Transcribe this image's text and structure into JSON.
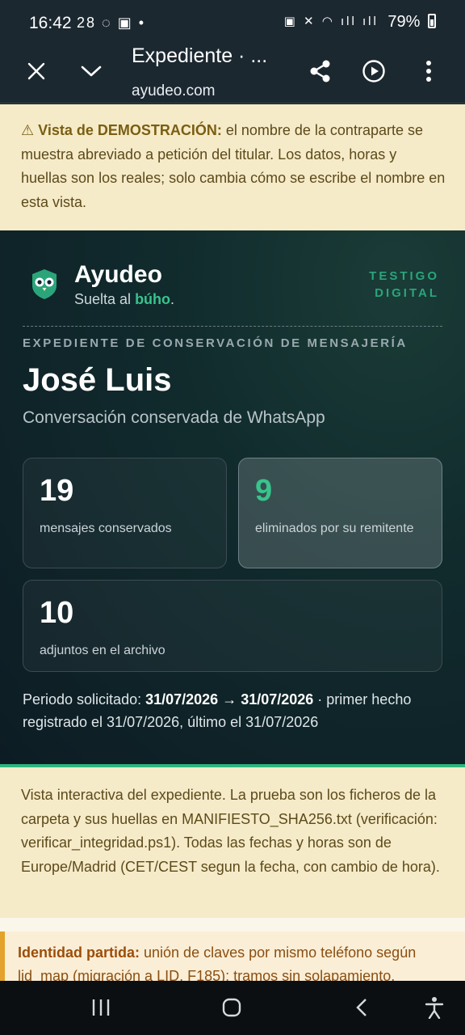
{
  "status_bar": {
    "time": "16:42",
    "notifications": "28 ◌ ▣ •",
    "right_icons": "▣ ✕ ◠ ıll ıll",
    "battery": "79%"
  },
  "browser": {
    "title": "Expediente · ...",
    "url": "ayudeo.com"
  },
  "demo_banner": {
    "label": "⚠ Vista de DEMOSTRACIÓN:",
    "text": " el nombre de la contraparte se muestra abreviado a petición del titular. Los datos, horas y huellas son los reales; solo cambia cómo se escribe el nombre en esta vista."
  },
  "brand": {
    "name": "Ayudeo",
    "tagline_prefix": "Suelta al ",
    "tagline_highlight": "búho",
    "tagline_suffix": ".",
    "badge_line1": "TESTIGO",
    "badge_line2": "DIGITAL"
  },
  "record": {
    "kicker": "EXPEDIENTE DE CONSERVACIÓN DE MENSAJERÍA",
    "name": "José Luis",
    "subtitle": "Conversación conservada de WhatsApp"
  },
  "stats": [
    {
      "value": "19",
      "label": "mensajes conservados"
    },
    {
      "value": "9",
      "label": "eliminados por su remitente"
    },
    {
      "value": "10",
      "label": "adjuntos en el archivo"
    }
  ],
  "period": {
    "prefix": "Periodo solicitado: ",
    "start": "31/07/2026",
    "arrow": " → ",
    "end": "31/07/2026",
    "suffix": " · primer hecho registrado el 31/07/2026, último el 31/07/2026"
  },
  "info_text": "Vista interactiva del expediente. La prueba son los ficheros de la carpeta y sus huellas en MANIFIESTO_SHA256.txt (verificación: verificar_integridad.ps1). Todas las fechas y horas son de Europe/Madrid (CET/CEST segun la fecha, con cambio de hora).",
  "alert": {
    "label": "Identidad partida:",
    "text": " unión de claves por mismo teléfono según lid_map (migración a LID, F185); tramos sin solapamiento."
  },
  "colors": {
    "accent_green": "#38c48c",
    "banner_bg": "#f5ebc9",
    "hero_bg": "#112b2d"
  }
}
